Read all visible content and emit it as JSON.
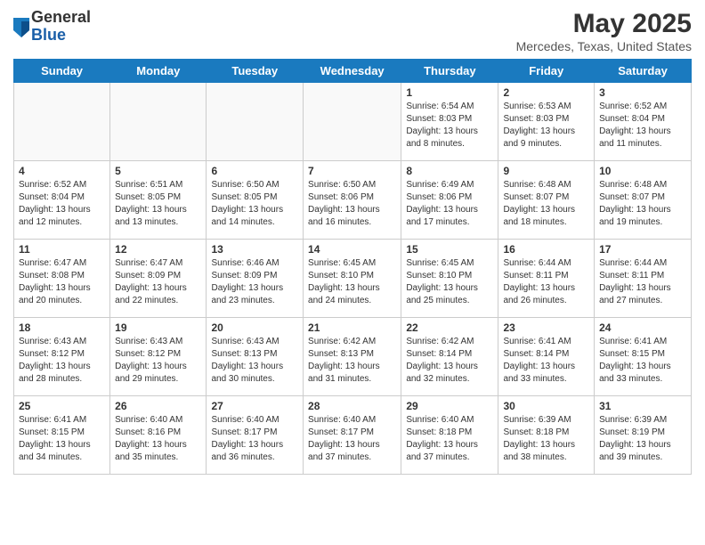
{
  "header": {
    "logo_general": "General",
    "logo_blue": "Blue",
    "title": "May 2025",
    "subtitle": "Mercedes, Texas, United States"
  },
  "weekdays": [
    "Sunday",
    "Monday",
    "Tuesday",
    "Wednesday",
    "Thursday",
    "Friday",
    "Saturday"
  ],
  "weeks": [
    [
      {
        "day": "",
        "info": ""
      },
      {
        "day": "",
        "info": ""
      },
      {
        "day": "",
        "info": ""
      },
      {
        "day": "",
        "info": ""
      },
      {
        "day": "1",
        "info": "Sunrise: 6:54 AM\nSunset: 8:03 PM\nDaylight: 13 hours\nand 8 minutes."
      },
      {
        "day": "2",
        "info": "Sunrise: 6:53 AM\nSunset: 8:03 PM\nDaylight: 13 hours\nand 9 minutes."
      },
      {
        "day": "3",
        "info": "Sunrise: 6:52 AM\nSunset: 8:04 PM\nDaylight: 13 hours\nand 11 minutes."
      }
    ],
    [
      {
        "day": "4",
        "info": "Sunrise: 6:52 AM\nSunset: 8:04 PM\nDaylight: 13 hours\nand 12 minutes."
      },
      {
        "day": "5",
        "info": "Sunrise: 6:51 AM\nSunset: 8:05 PM\nDaylight: 13 hours\nand 13 minutes."
      },
      {
        "day": "6",
        "info": "Sunrise: 6:50 AM\nSunset: 8:05 PM\nDaylight: 13 hours\nand 14 minutes."
      },
      {
        "day": "7",
        "info": "Sunrise: 6:50 AM\nSunset: 8:06 PM\nDaylight: 13 hours\nand 16 minutes."
      },
      {
        "day": "8",
        "info": "Sunrise: 6:49 AM\nSunset: 8:06 PM\nDaylight: 13 hours\nand 17 minutes."
      },
      {
        "day": "9",
        "info": "Sunrise: 6:48 AM\nSunset: 8:07 PM\nDaylight: 13 hours\nand 18 minutes."
      },
      {
        "day": "10",
        "info": "Sunrise: 6:48 AM\nSunset: 8:07 PM\nDaylight: 13 hours\nand 19 minutes."
      }
    ],
    [
      {
        "day": "11",
        "info": "Sunrise: 6:47 AM\nSunset: 8:08 PM\nDaylight: 13 hours\nand 20 minutes."
      },
      {
        "day": "12",
        "info": "Sunrise: 6:47 AM\nSunset: 8:09 PM\nDaylight: 13 hours\nand 22 minutes."
      },
      {
        "day": "13",
        "info": "Sunrise: 6:46 AM\nSunset: 8:09 PM\nDaylight: 13 hours\nand 23 minutes."
      },
      {
        "day": "14",
        "info": "Sunrise: 6:45 AM\nSunset: 8:10 PM\nDaylight: 13 hours\nand 24 minutes."
      },
      {
        "day": "15",
        "info": "Sunrise: 6:45 AM\nSunset: 8:10 PM\nDaylight: 13 hours\nand 25 minutes."
      },
      {
        "day": "16",
        "info": "Sunrise: 6:44 AM\nSunset: 8:11 PM\nDaylight: 13 hours\nand 26 minutes."
      },
      {
        "day": "17",
        "info": "Sunrise: 6:44 AM\nSunset: 8:11 PM\nDaylight: 13 hours\nand 27 minutes."
      }
    ],
    [
      {
        "day": "18",
        "info": "Sunrise: 6:43 AM\nSunset: 8:12 PM\nDaylight: 13 hours\nand 28 minutes."
      },
      {
        "day": "19",
        "info": "Sunrise: 6:43 AM\nSunset: 8:12 PM\nDaylight: 13 hours\nand 29 minutes."
      },
      {
        "day": "20",
        "info": "Sunrise: 6:43 AM\nSunset: 8:13 PM\nDaylight: 13 hours\nand 30 minutes."
      },
      {
        "day": "21",
        "info": "Sunrise: 6:42 AM\nSunset: 8:13 PM\nDaylight: 13 hours\nand 31 minutes."
      },
      {
        "day": "22",
        "info": "Sunrise: 6:42 AM\nSunset: 8:14 PM\nDaylight: 13 hours\nand 32 minutes."
      },
      {
        "day": "23",
        "info": "Sunrise: 6:41 AM\nSunset: 8:14 PM\nDaylight: 13 hours\nand 33 minutes."
      },
      {
        "day": "24",
        "info": "Sunrise: 6:41 AM\nSunset: 8:15 PM\nDaylight: 13 hours\nand 33 minutes."
      }
    ],
    [
      {
        "day": "25",
        "info": "Sunrise: 6:41 AM\nSunset: 8:15 PM\nDaylight: 13 hours\nand 34 minutes."
      },
      {
        "day": "26",
        "info": "Sunrise: 6:40 AM\nSunset: 8:16 PM\nDaylight: 13 hours\nand 35 minutes."
      },
      {
        "day": "27",
        "info": "Sunrise: 6:40 AM\nSunset: 8:17 PM\nDaylight: 13 hours\nand 36 minutes."
      },
      {
        "day": "28",
        "info": "Sunrise: 6:40 AM\nSunset: 8:17 PM\nDaylight: 13 hours\nand 37 minutes."
      },
      {
        "day": "29",
        "info": "Sunrise: 6:40 AM\nSunset: 8:18 PM\nDaylight: 13 hours\nand 37 minutes."
      },
      {
        "day": "30",
        "info": "Sunrise: 6:39 AM\nSunset: 8:18 PM\nDaylight: 13 hours\nand 38 minutes."
      },
      {
        "day": "31",
        "info": "Sunrise: 6:39 AM\nSunset: 8:19 PM\nDaylight: 13 hours\nand 39 minutes."
      }
    ]
  ]
}
